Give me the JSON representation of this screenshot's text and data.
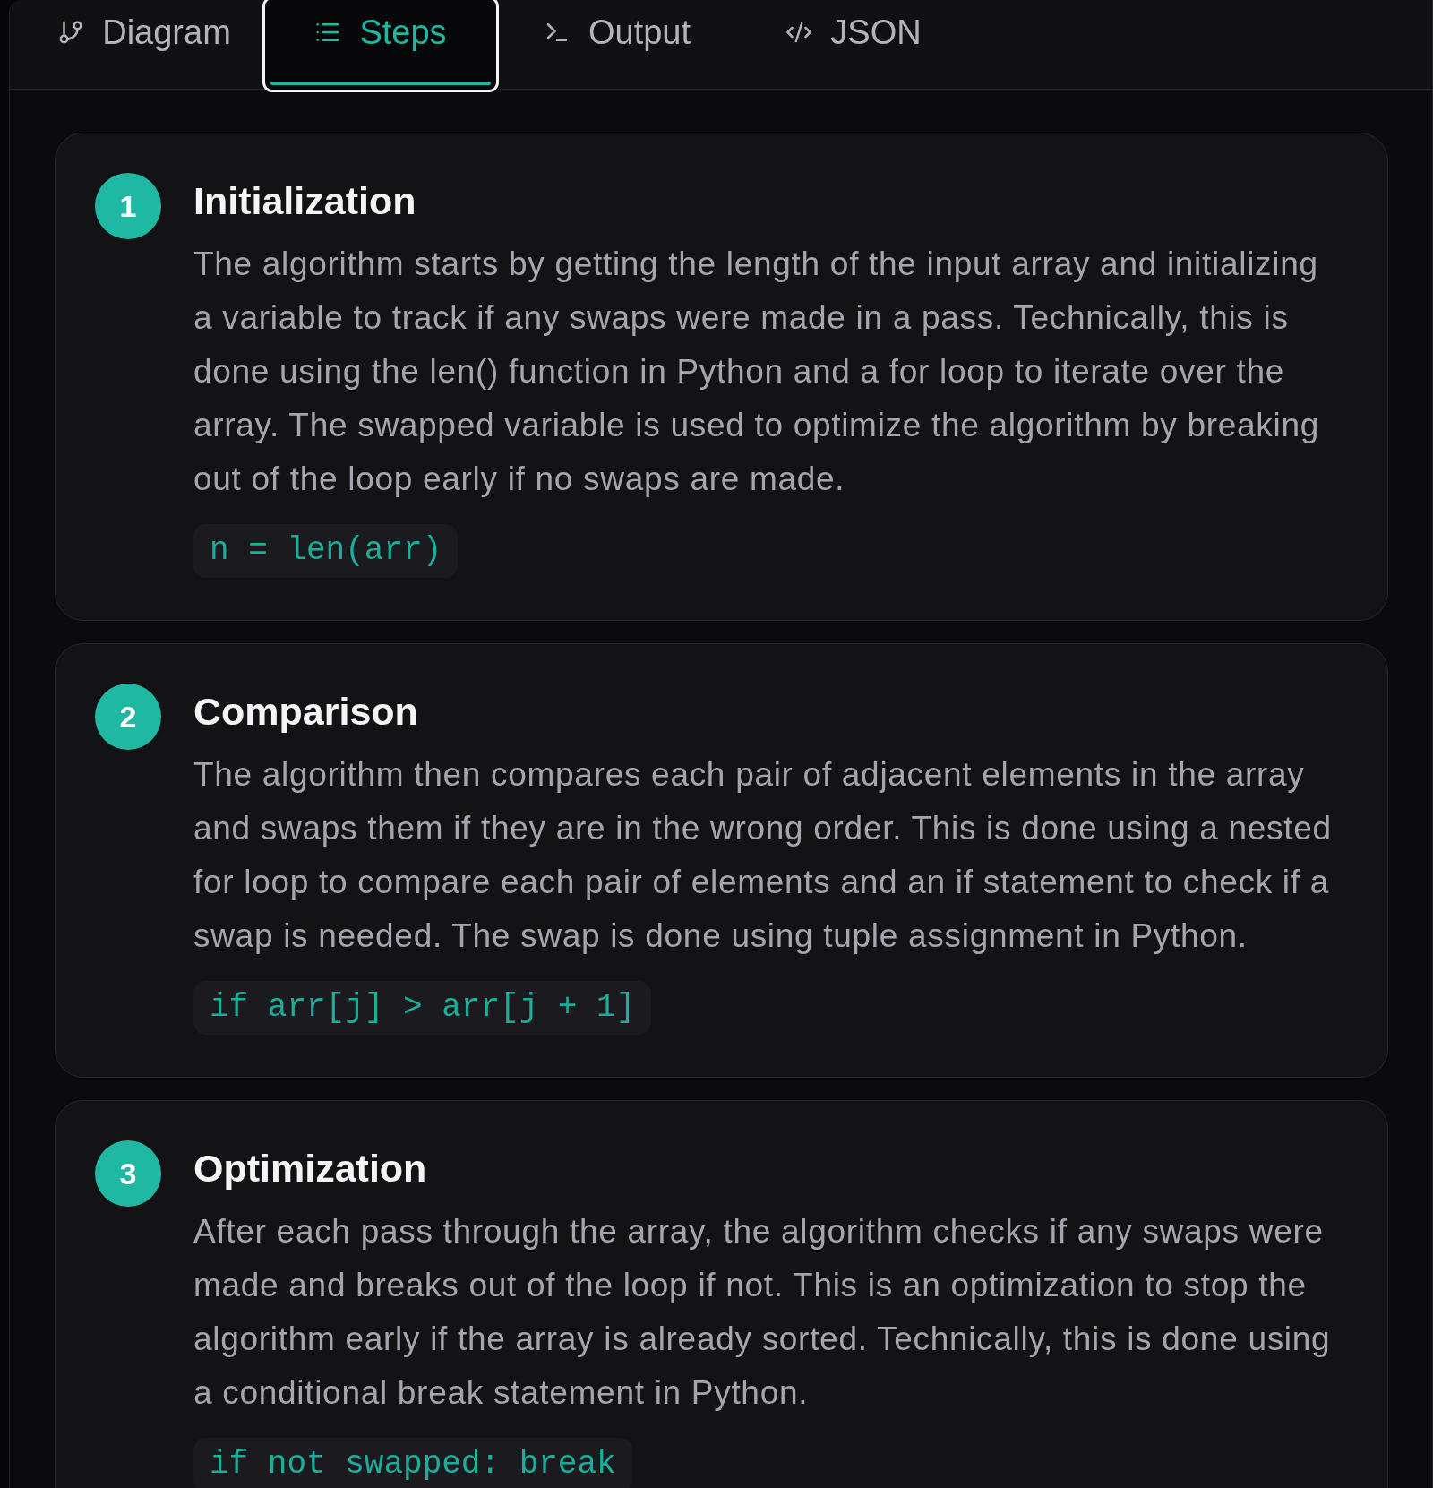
{
  "tabs": [
    {
      "label": "Diagram",
      "kind": "branch",
      "selected": false
    },
    {
      "label": "Steps",
      "kind": "list",
      "selected": true
    },
    {
      "label": "Output",
      "kind": "terminal",
      "selected": false
    },
    {
      "label": "JSON",
      "kind": "code",
      "selected": false
    }
  ],
  "steps": [
    {
      "number": "1",
      "title": "Initialization",
      "description": "The algorithm starts by getting the length of the input array and initializing a variable to track if any swaps were made in a pass. Technically, this is done using the len() function in Python and a for loop to iterate over the array. The swapped variable is used to optimize the algorithm by breaking out of the loop early if no swaps are made.",
      "code": "n = len(arr)"
    },
    {
      "number": "2",
      "title": "Comparison",
      "description": "The algorithm then compares each pair of adjacent elements in the array and swaps them if they are in the wrong order. This is done using a nested for loop to compare each pair of elements and an if statement to check if a swap is needed. The swap is done using tuple assignment in Python.",
      "code": "if arr[j] > arr[j + 1]"
    },
    {
      "number": "3",
      "title": "Optimization",
      "description": "After each pass through the array, the algorithm checks if any swaps were made and breaks out of the loop if not. This is an optimization to stop the algorithm early if the array is already sorted. Technically, this is done using a conditional break statement in Python.",
      "code": "if not swapped: break"
    }
  ]
}
